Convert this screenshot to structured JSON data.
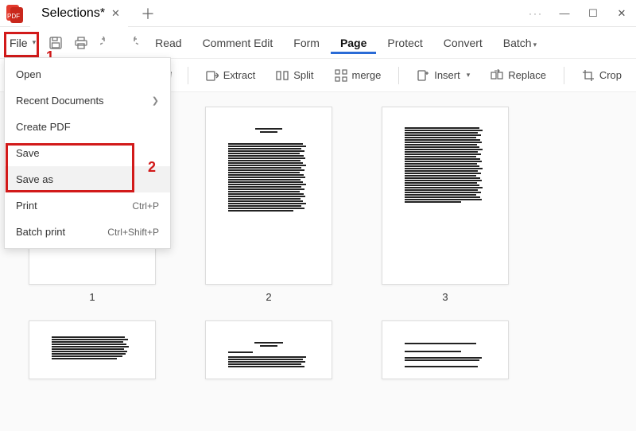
{
  "titlebar": {
    "tab_name": "Selections*",
    "window_controls": {
      "ellipsis": "···",
      "min": "—",
      "max": "☐",
      "close": "✕"
    }
  },
  "menubar": {
    "file_label": "File",
    "items": [
      "Read",
      "Comment Edit",
      "Form",
      "Page",
      "Protect",
      "Convert",
      "Batch"
    ]
  },
  "toolbar": {
    "extract": "Extract",
    "split": "Split",
    "merge": "merge",
    "insert": "Insert",
    "replace": "Replace",
    "crop": "Crop"
  },
  "file_menu": {
    "open": "Open",
    "recent": "Recent Documents",
    "create": "Create PDF",
    "save": "Save",
    "save_as": "Save as",
    "print": "Print",
    "print_sc": "Ctrl+P",
    "batch_print": "Batch print",
    "batch_print_sc": "Ctrl+Shift+P"
  },
  "annotations": {
    "one": "1",
    "two": "2"
  },
  "pages": {
    "nums": [
      "1",
      "2",
      "3"
    ]
  }
}
